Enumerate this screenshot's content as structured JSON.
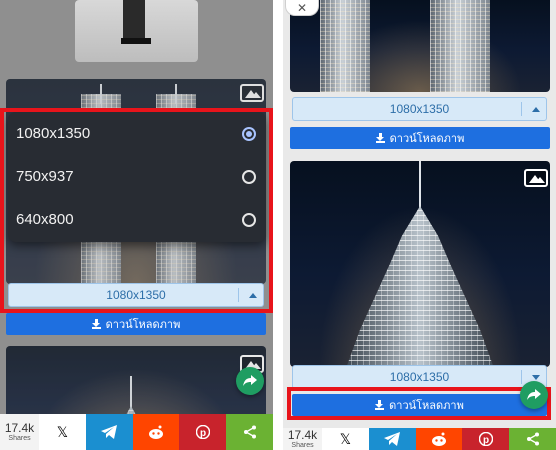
{
  "left": {
    "dropdown_options": [
      {
        "label": "1080x1350",
        "selected": true
      },
      {
        "label": "750x937",
        "selected": false
      },
      {
        "label": "640x800",
        "selected": false
      }
    ],
    "select_value": "1080x1350",
    "download_label": "ดาวน์โหลดภาพ"
  },
  "right": {
    "card1_select_value": "1080x1350",
    "card1_download_label": "ดาวน์โหลดภาพ",
    "card2_select_value": "1080x1350",
    "card2_download_label": "ดาวน์โหลดภาพ",
    "close_glyph": "✕"
  },
  "share": {
    "count": "17.4k",
    "count_label": "Shares",
    "buttons": [
      {
        "icon": "x-icon",
        "color": "#000000"
      },
      {
        "icon": "telegram-icon",
        "color": "#1b8fd0"
      },
      {
        "icon": "reddit-icon",
        "color": "#ff4500"
      },
      {
        "icon": "pinterest-icon",
        "color": "#c8232c"
      },
      {
        "icon": "share-icon",
        "color": "#6bb233"
      }
    ]
  },
  "colors": {
    "highlight": "#e8141b",
    "download_button": "#1e6fe0",
    "fab": "#1f9d62"
  }
}
